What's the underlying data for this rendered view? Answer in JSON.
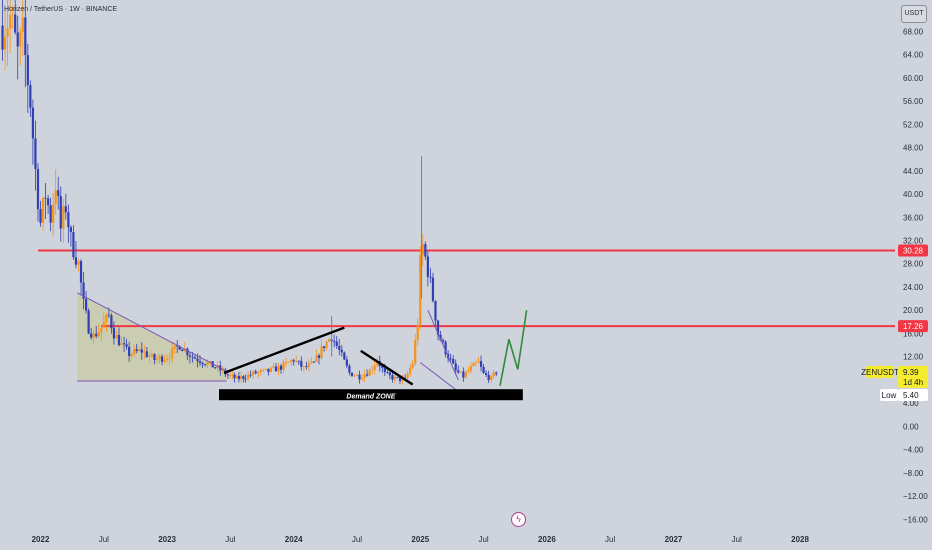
{
  "header": {
    "title": "Horizen / TetherUS · 1W · BINANCE",
    "currency": "USDT"
  },
  "colors": {
    "up": "#f7931a",
    "down": "#2f3fb5",
    "resistance": "#f23645",
    "trend": "#000000",
    "forecast": "#2e8b3a",
    "triangle_fill": "#c9c98f",
    "triangle_line": "#7b56b8",
    "tag_yellow": "#f5ec2f"
  },
  "tags": {
    "symbol": "ZENUSDT",
    "price": "9.39",
    "countdown": "1d 4h",
    "low_label": "Low",
    "low_value": "5.40"
  },
  "annotations": {
    "demand_zone": "Demand ZONE"
  },
  "chart_data": {
    "type": "candlestick",
    "title": "Horizen / TetherUS · 1W · BINANCE",
    "xlabel": "",
    "ylabel": "",
    "ylim": [
      -17.5,
      71
    ],
    "xlim": [
      2021.68,
      2028.75
    ],
    "y_ticks": [
      "68.00",
      "64.00",
      "60.00",
      "56.00",
      "52.00",
      "48.00",
      "44.00",
      "40.00",
      "36.00",
      "32.00",
      "28.00",
      "24.00",
      "20.00",
      "16.00",
      "12.00",
      "8.00",
      "4.00",
      "0.00",
      "−4.00",
      "−8.00",
      "−12.00",
      "−16.00"
    ],
    "y_tick_values": [
      68,
      64,
      60,
      56,
      52,
      48,
      44,
      40,
      36,
      32,
      28,
      24,
      20,
      16,
      12,
      8,
      4,
      0,
      -4,
      -8,
      -12,
      -16
    ],
    "x_ticks": [
      {
        "label": "2022",
        "x": 2022.0,
        "bold": true
      },
      {
        "label": "Jul",
        "x": 2022.5,
        "bold": false
      },
      {
        "label": "2023",
        "x": 2023.0,
        "bold": true
      },
      {
        "label": "Jul",
        "x": 2023.5,
        "bold": false
      },
      {
        "label": "2024",
        "x": 2024.0,
        "bold": true
      },
      {
        "label": "Jul",
        "x": 2024.5,
        "bold": false
      },
      {
        "label": "2025",
        "x": 2025.0,
        "bold": true
      },
      {
        "label": "Jul",
        "x": 2025.5,
        "bold": false
      },
      {
        "label": "2026",
        "x": 2026.0,
        "bold": true
      },
      {
        "label": "Jul",
        "x": 2026.5,
        "bold": false
      },
      {
        "label": "2027",
        "x": 2027.0,
        "bold": true
      },
      {
        "label": "Jul",
        "x": 2027.5,
        "bold": false
      },
      {
        "label": "2028",
        "x": 2028.0,
        "bold": true
      }
    ],
    "horizontal_levels": [
      {
        "value": 30.28,
        "label": "30.28",
        "x_start": 2021.98
      },
      {
        "value": 17.26,
        "label": "17.26",
        "x_start": 2022.48
      }
    ],
    "candle_anchors": [
      [
        2021.7,
        69.0
      ],
      [
        2021.76,
        70.5
      ],
      [
        2021.82,
        64.0
      ],
      [
        2021.86,
        67.0
      ],
      [
        2021.92,
        56.0
      ],
      [
        2021.96,
        44.0
      ],
      [
        2022.0,
        35.0
      ],
      [
        2022.04,
        40.0
      ],
      [
        2022.08,
        36.0
      ],
      [
        2022.12,
        42.0
      ],
      [
        2022.16,
        34.0
      ],
      [
        2022.2,
        38.0
      ],
      [
        2022.24,
        32.0
      ],
      [
        2022.3,
        28.0
      ],
      [
        2022.34,
        21.0
      ],
      [
        2022.38,
        17.0
      ],
      [
        2022.42,
        15.5
      ],
      [
        2022.48,
        17.0
      ],
      [
        2022.54,
        19.0
      ],
      [
        2022.58,
        16.0
      ],
      [
        2022.64,
        14.0
      ],
      [
        2022.7,
        12.5
      ],
      [
        2022.8,
        13.0
      ],
      [
        2022.9,
        11.5
      ],
      [
        2023.0,
        12.0
      ],
      [
        2023.1,
        14.0
      ],
      [
        2023.2,
        12.0
      ],
      [
        2023.3,
        11.0
      ],
      [
        2023.4,
        10.0
      ],
      [
        2023.48,
        8.8
      ],
      [
        2023.55,
        8.2
      ],
      [
        2023.62,
        8.6
      ],
      [
        2023.7,
        9.2
      ],
      [
        2023.8,
        9.5
      ],
      [
        2023.9,
        10.2
      ],
      [
        2024.0,
        11.5
      ],
      [
        2024.08,
        10.0
      ],
      [
        2024.16,
        10.8
      ],
      [
        2024.24,
        14.0
      ],
      [
        2024.3,
        15.5
      ],
      [
        2024.36,
        13.0
      ],
      [
        2024.44,
        9.2
      ],
      [
        2024.52,
        8.6
      ],
      [
        2024.6,
        9.5
      ],
      [
        2024.66,
        11.5
      ],
      [
        2024.72,
        9.0
      ],
      [
        2024.8,
        8.2
      ],
      [
        2024.88,
        8.0
      ],
      [
        2024.94,
        11.0
      ],
      [
        2024.98,
        18.0
      ],
      [
        2025.0,
        28.0
      ],
      [
        2025.02,
        31.0
      ],
      [
        2025.06,
        27.0
      ],
      [
        2025.1,
        22.0
      ],
      [
        2025.14,
        16.0
      ],
      [
        2025.2,
        13.0
      ],
      [
        2025.28,
        9.5
      ],
      [
        2025.34,
        8.6
      ],
      [
        2025.4,
        10.0
      ],
      [
        2025.46,
        11.0
      ],
      [
        2025.5,
        9.0
      ],
      [
        2025.56,
        8.2
      ],
      [
        2025.6,
        9.39
      ]
    ],
    "wick_spikes": [
      {
        "x": 2025.01,
        "low": 22.0,
        "high": 46.5
      },
      {
        "x": 2024.3,
        "low": 12.0,
        "high": 19.0
      }
    ],
    "trendlines": [
      {
        "name": "descending-triangle-top",
        "color": "triangle_line",
        "x1": 2022.29,
        "y1": 23.0,
        "x2": 2023.47,
        "y2": 9.5
      },
      {
        "name": "triangle-base",
        "color": "triangle_line",
        "x1": 2022.29,
        "y1": 7.8,
        "x2": 2023.47,
        "y2": 7.8
      },
      {
        "name": "ascending-trendline",
        "color": "trend",
        "x1": 2023.45,
        "y1": 9.2,
        "x2": 2024.4,
        "y2": 17.0
      },
      {
        "name": "descending-trendline",
        "color": "trend",
        "x1": 2024.53,
        "y1": 13.0,
        "x2": 2024.94,
        "y2": 7.2
      },
      {
        "name": "falling-wedge-upper",
        "color": "triangle_line",
        "x1": 2025.06,
        "y1": 20.0,
        "x2": 2025.3,
        "y2": 8.0
      },
      {
        "name": "falling-wedge-lower",
        "color": "triangle_line",
        "x1": 2025.0,
        "y1": 11.0,
        "x2": 2025.3,
        "y2": 6.0
      }
    ],
    "demand_zone": {
      "x1": 2023.41,
      "x2": 2025.81,
      "y_top": 6.4,
      "y_bottom": 4.5
    },
    "forecast_path": [
      {
        "x": 2025.63,
        "y": 7.0
      },
      {
        "x": 2025.7,
        "y": 15.0
      },
      {
        "x": 2025.77,
        "y": 9.8
      },
      {
        "x": 2025.84,
        "y": 20.0
      }
    ]
  }
}
